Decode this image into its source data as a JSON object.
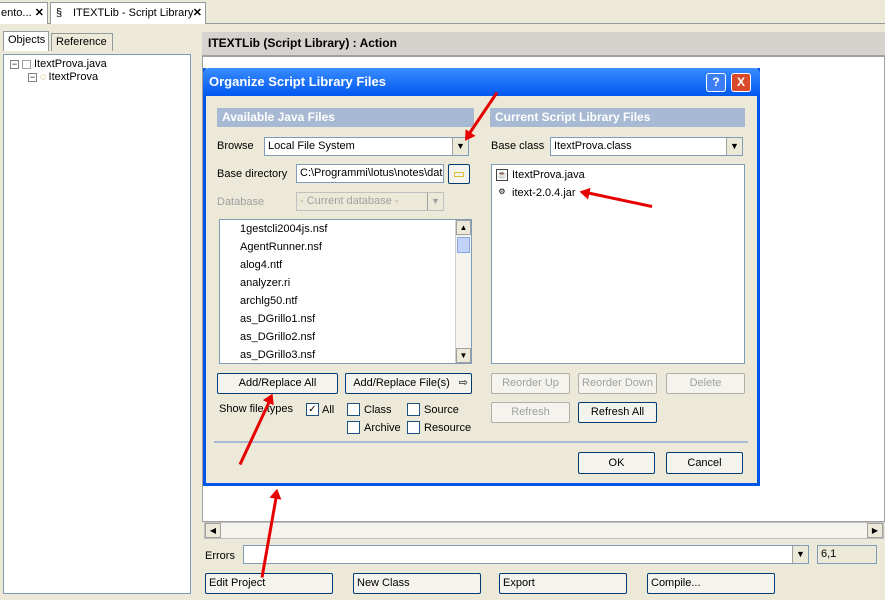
{
  "tabs": [
    {
      "label": "ento..."
    },
    {
      "label": "ITEXTLib - Script Library"
    }
  ],
  "left_panel": {
    "tabs": [
      "Objects",
      "Reference"
    ],
    "tree": [
      {
        "label": "ItextProva.java"
      },
      {
        "label": "ItextProva"
      }
    ]
  },
  "editor": {
    "header": "ITEXTLib (Script Library) : Action"
  },
  "errors": {
    "label": "Errors",
    "position": "6,1"
  },
  "bottom_buttons": [
    "Edit Project",
    "New Class",
    "Export",
    "Compile..."
  ],
  "dialog": {
    "title": "Organize Script Library Files",
    "help": "?",
    "close": "X",
    "available": {
      "header": "Available Java Files",
      "browse_label": "Browse",
      "browse_value": "Local File System",
      "basedir_label": "Base directory",
      "basedir_value": "C:\\Programmi\\lotus\\notes\\dat",
      "database_label": "Database",
      "database_value": "- Current database -",
      "files": [
        "1gestcli2004js.nsf",
        "AgentRunner.nsf",
        "alog4.ntf",
        "analyzer.ri",
        "archlg50.ntf",
        "as_DGrillo1.nsf",
        "as_DGrillo2.nsf",
        "as_DGrillo3.nsf"
      ],
      "add_all": "Add/Replace All",
      "add_files": "Add/Replace File(s)",
      "show_label": "Show file types",
      "types": [
        "All",
        "Class",
        "Source",
        "Archive",
        "Resource"
      ]
    },
    "current": {
      "header": "Current Script Library Files",
      "baseclass_label": "Base class",
      "baseclass_value": "ItextProva.class",
      "files": [
        "ItextProva.java",
        "itext-2.0.4.jar"
      ],
      "reorder_up": "Reorder Up",
      "reorder_down": "Reorder Down",
      "delete": "Delete",
      "refresh": "Refresh",
      "refresh_all": "Refresh All"
    },
    "ok": "OK",
    "cancel": "Cancel"
  }
}
